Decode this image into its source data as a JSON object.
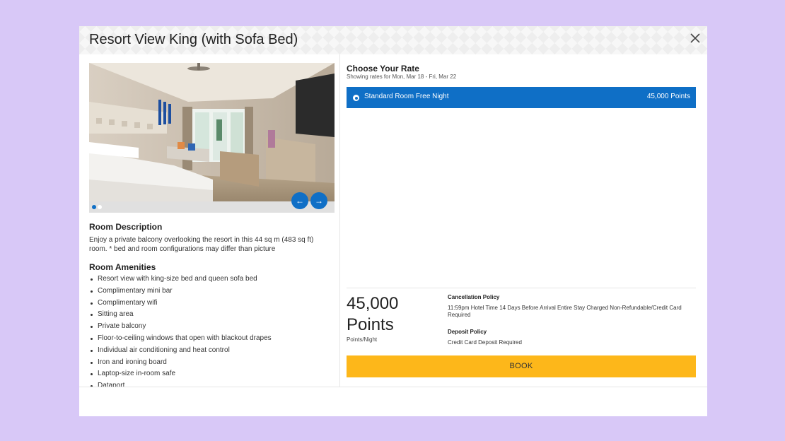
{
  "modal": {
    "title": "Resort View King (with Sofa Bed)",
    "close_icon": "close-icon"
  },
  "gallery": {
    "prev_icon": "arrow-left-icon",
    "next_icon": "arrow-right-icon",
    "prev_glyph": "←",
    "next_glyph": "→",
    "image_count": 2,
    "active_index": 0
  },
  "room": {
    "description_heading": "Room Description",
    "description": "Enjoy a private balcony overlooking the resort in this 44 sq m (483 sq ft) room. * bed and room configurations may differ than picture",
    "amenities_heading": "Room Amenities",
    "amenities": [
      "Resort view with king-size bed and queen sofa bed",
      "Complimentary mini bar",
      "Complimentary wifi",
      "Sitting area",
      "Private balcony",
      "Floor-to-ceiling windows that open with blackout drapes",
      "Individual air conditioning and heat control",
      "Iron and ironing board",
      "Laptop-size in-room safe",
      "Dataport"
    ]
  },
  "rates": {
    "heading": "Choose Your Rate",
    "subheading": "Showing rates for Mon, Mar 18 - Fri, Mar 22",
    "options": [
      {
        "name": "Standard Room Free Night",
        "points": "45,000 Points",
        "selected": true
      }
    ]
  },
  "summary": {
    "price": "45,000 Points",
    "unit": "Points/Night",
    "cancellation_title": "Cancellation Policy",
    "cancellation_text": "11:59pm Hotel Time 14 Days Before Arrival Entire Stay Charged Non-Refundable/Credit Card Required",
    "deposit_title": "Deposit Policy",
    "deposit_text": "Credit Card Deposit Required",
    "book_label": "BOOK"
  },
  "colors": {
    "accent_blue": "#0f6fc6",
    "book_yellow": "#fdb71a",
    "backdrop": "#d8c8f7"
  }
}
